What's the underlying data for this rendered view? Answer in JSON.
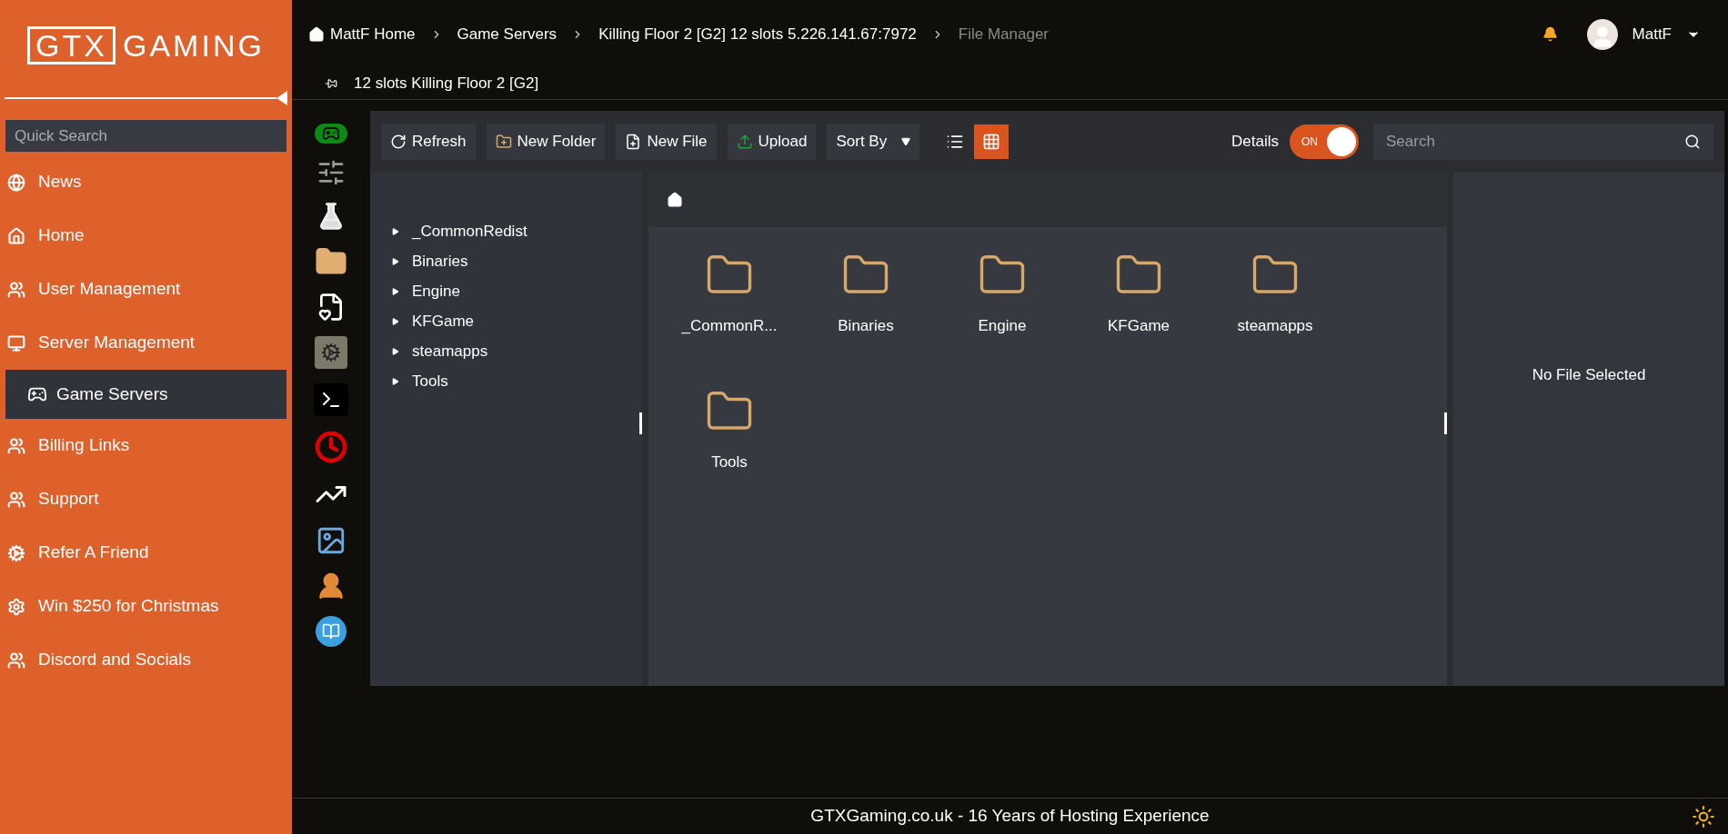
{
  "logo": {
    "boxed": "GTX",
    "rest": "GAMING"
  },
  "quick_search": {
    "placeholder": "Quick Search"
  },
  "nav": [
    {
      "label": "News",
      "selected": false
    },
    {
      "label": "Home",
      "selected": false
    },
    {
      "label": "User Management",
      "selected": false
    },
    {
      "label": "Server Management",
      "selected": false,
      "children": [
        {
          "label": "Game Servers",
          "selected": true
        }
      ]
    },
    {
      "label": "Billing Links",
      "selected": false
    },
    {
      "label": "Support",
      "selected": false
    },
    {
      "label": "Refer A Friend",
      "selected": false
    },
    {
      "label": "Win $250 for Christmas",
      "selected": false
    },
    {
      "label": "Discord and Socials",
      "selected": false
    }
  ],
  "breadcrumbs": [
    {
      "label": "MattF Home",
      "current": false
    },
    {
      "label": "Game Servers",
      "current": false
    },
    {
      "label": "Killing Floor 2 [G2] 12 slots 5.226.141.67:7972",
      "current": false
    },
    {
      "label": "File Manager",
      "current": true
    }
  ],
  "user": {
    "name": "MattF"
  },
  "server_title": "12 slots Killing Floor 2 [G2]",
  "toolbar": {
    "buttons": [
      "Refresh",
      "New Folder",
      "New File",
      "Upload"
    ],
    "sort": "Sort By",
    "views": [
      {
        "kind": "list",
        "selected": false
      },
      {
        "kind": "grid",
        "selected": true
      }
    ],
    "details_label": "Details",
    "details_toggle": {
      "on": true,
      "label": "ON"
    },
    "search": {
      "placeholder": "Search"
    }
  },
  "tree": [
    {
      "label": "_CommonRedist",
      "expanded": false
    },
    {
      "label": "Binaries",
      "expanded": false
    },
    {
      "label": "Engine",
      "expanded": false
    },
    {
      "label": "KFGame",
      "expanded": false
    },
    {
      "label": "steamapps",
      "expanded": false
    },
    {
      "label": "Tools",
      "expanded": false
    }
  ],
  "files": [
    {
      "name": "_CommonR..."
    },
    {
      "name": "Binaries"
    },
    {
      "name": "Engine"
    },
    {
      "name": "KFGame"
    },
    {
      "name": "steamapps"
    },
    {
      "name": "Tools"
    }
  ],
  "details_panel": {
    "message": "No File Selected"
  },
  "footer": "GTXGaming.co.uk - 16 Years of Hosting Experience"
}
